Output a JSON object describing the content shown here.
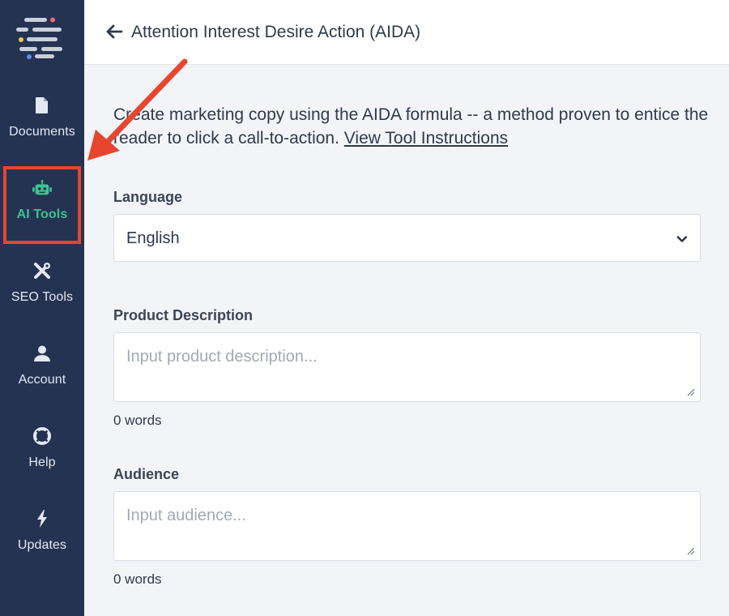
{
  "sidebar": {
    "items": [
      {
        "label": "Documents",
        "icon": "document-icon"
      },
      {
        "label": "AI Tools",
        "icon": "robot-icon",
        "active": true
      },
      {
        "label": "SEO Tools",
        "icon": "tools-icon"
      },
      {
        "label": "Account",
        "icon": "user-icon"
      },
      {
        "label": "Help",
        "icon": "lifebuoy-icon"
      },
      {
        "label": "Updates",
        "icon": "bolt-icon"
      }
    ]
  },
  "header": {
    "title": "Attention Interest Desire Action (AIDA)"
  },
  "intro": {
    "text": "Create marketing copy using the AIDA formula -- a method proven to entice the reader to click a call-to-action.",
    "link": "View Tool Instructions"
  },
  "form": {
    "language": {
      "label": "Language",
      "value": "English"
    },
    "product_description": {
      "label": "Product Description",
      "placeholder": "Input product description...",
      "word_count": "0 words"
    },
    "audience": {
      "label": "Audience",
      "placeholder": "Input audience...",
      "word_count": "0 words"
    }
  },
  "colors": {
    "sidebar_bg": "#243352",
    "active": "#3ec28f",
    "annotation": "#e8452f"
  }
}
